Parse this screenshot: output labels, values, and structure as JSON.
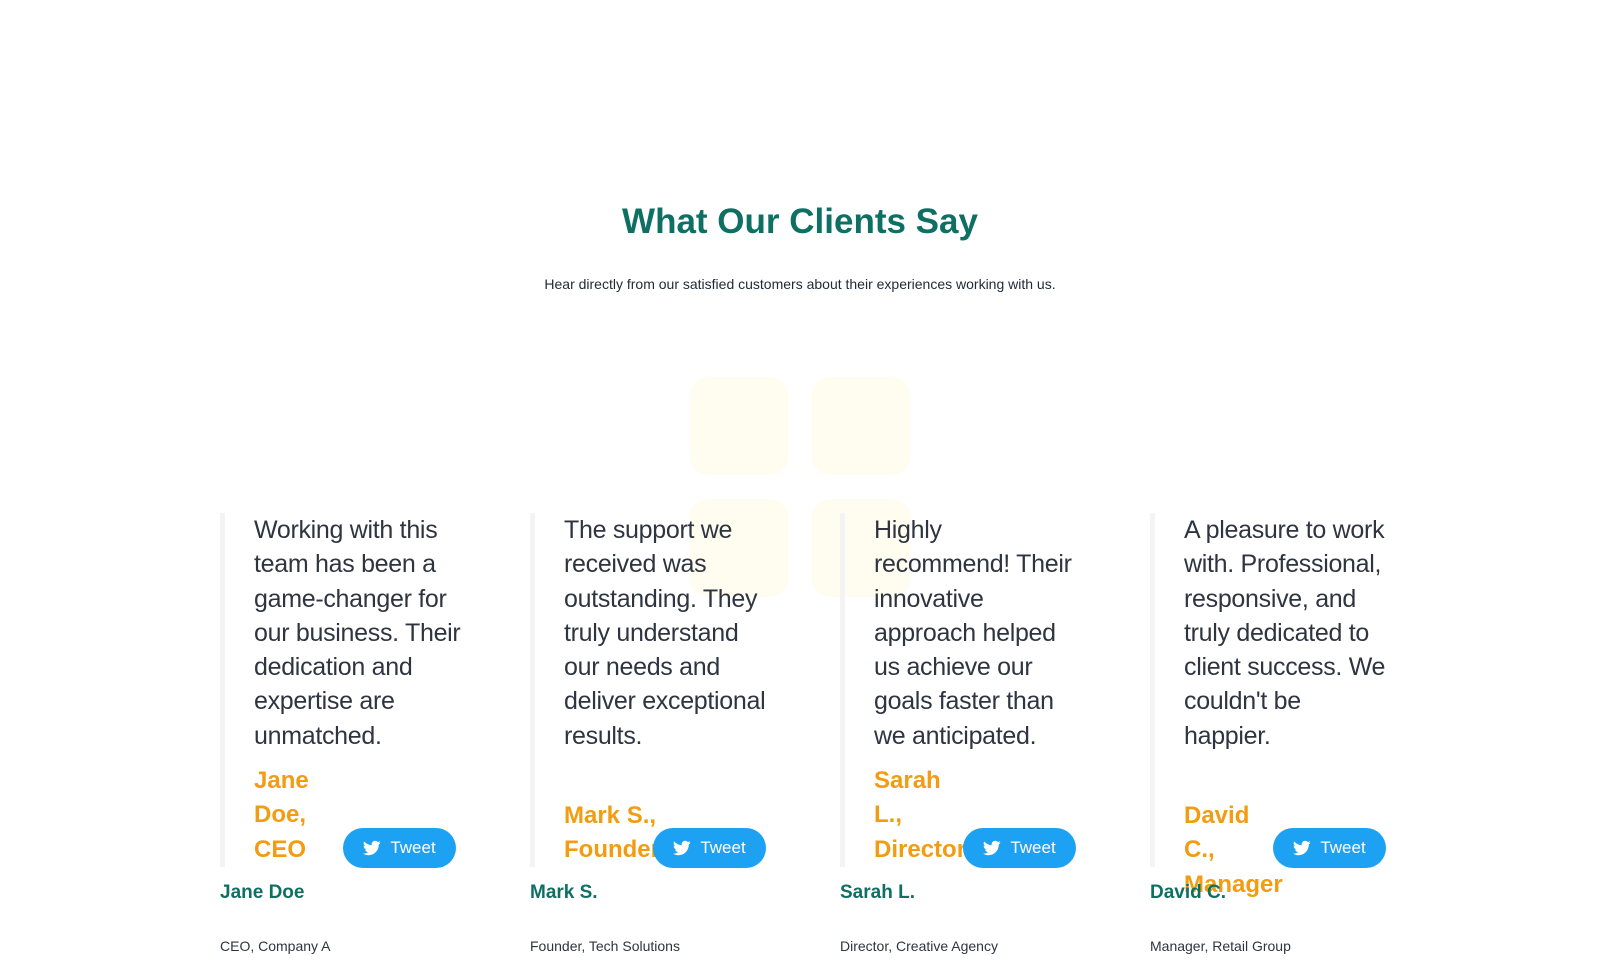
{
  "section": {
    "title": "What Our Clients Say",
    "subtitle": "Hear directly from our satisfied customers about their experiences working with us."
  },
  "testimonials": [
    {
      "quote": "Working with this team has been a game-changer for our business. Their dedication and expertise are unmatched.",
      "cite": "Jane Doe, CEO",
      "tweet_label": "Tweet",
      "name": "Jane Doe",
      "role": "CEO, Company A"
    },
    {
      "quote": "The support we received was outstanding. They truly understand our needs and deliver exceptional results.",
      "cite": "Mark S., Founder",
      "tweet_label": "Tweet",
      "name": "Mark S.",
      "role": "Founder, Tech Solutions"
    },
    {
      "quote": "Highly recommend! Their innovative approach helped us achieve our goals faster than we anticipated.",
      "cite": "Sarah L., Director",
      "tweet_label": "Tweet",
      "name": "Sarah L.",
      "role": "Director, Creative Agency"
    },
    {
      "quote": "A pleasure to work with. Professional, responsive, and truly dedicated to client success. We couldn't be happier.",
      "cite": "David C., Manager",
      "tweet_label": "Tweet",
      "name": "David C.",
      "role": "Manager, Retail Group"
    }
  ],
  "icons": {
    "tweet": "twitter-bird-icon"
  },
  "colors": {
    "title": "#0e7063",
    "cite": "#f39c12",
    "tweet_button": "#1da1f2"
  }
}
